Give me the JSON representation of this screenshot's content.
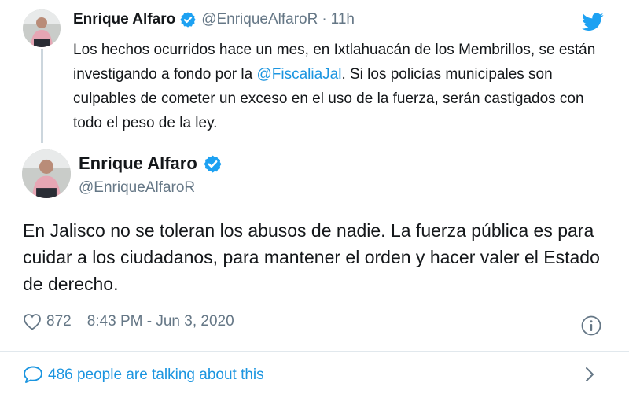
{
  "parent_tweet": {
    "name": "Enrique Alfaro",
    "handle": "@EnriqueAlfaroR",
    "separator": "·",
    "time": "11h",
    "text_part1": "Los hechos ocurridos hace un mes, en Ixtlahuacán de los Membrillos, se están investigando a fondo por la ",
    "mention": "@FiscaliaJal",
    "text_part2": ". Si los policías municipales son culpables de cometer un exceso en el uso de la fuerza, serán castigados con todo el peso de la ley."
  },
  "main_tweet": {
    "name": "Enrique Alfaro",
    "handle": "@EnriqueAlfaroR",
    "text": "En Jalisco no se toleran los abusos de nadie. La fuerza pública es para cuidar a los ciudadanos, para mantener el orden y hacer valer el Estado de derecho.",
    "likes": "872",
    "timestamp": "8:43 PM - Jun 3, 2020"
  },
  "conversation": {
    "label": "486 people are talking about this"
  },
  "icons": {
    "verified": "verified-badge-icon",
    "bird": "twitter-bird-icon",
    "like": "heart-icon",
    "info": "info-icon",
    "reply": "speech-bubble-icon",
    "chevron": "chevron-right-icon"
  },
  "colors": {
    "link_blue": "#1b95e0",
    "verified_blue": "#1da1f2",
    "secondary_text": "#657786",
    "primary_text": "#14171a",
    "divider": "#e1e8ed"
  }
}
